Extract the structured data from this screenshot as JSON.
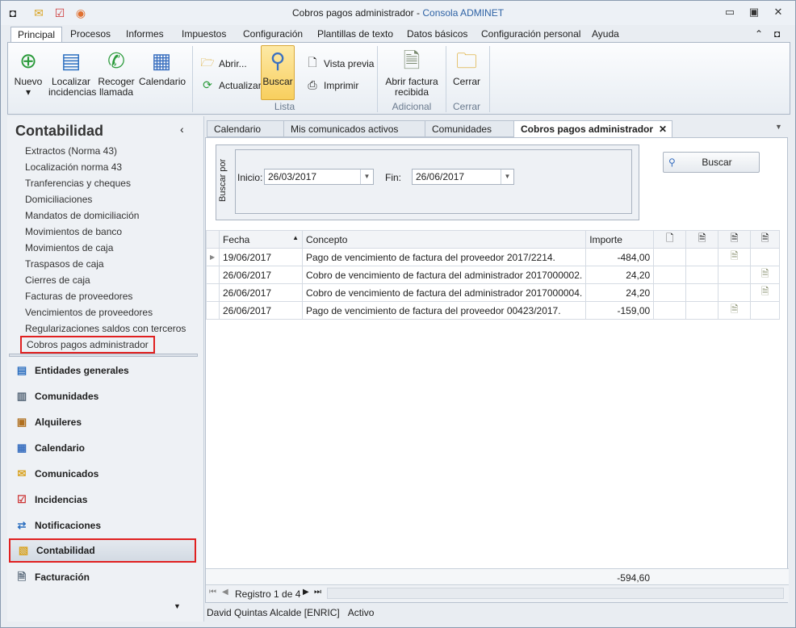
{
  "window": {
    "title": "Cobros pagos administrador",
    "app": "Consola ADMINET",
    "separator": " - "
  },
  "quick_access": [
    "app-icon",
    "mail-icon",
    "tasks-icon",
    "signal-icon"
  ],
  "ribbon_tabs": [
    "Principal",
    "Procesos",
    "Informes",
    "Impuestos",
    "Configuración",
    "Plantillas de texto",
    "Datos básicos",
    "Configuración personal",
    "Ayuda"
  ],
  "ribbon": {
    "nuevo": "Nuevo",
    "localizar": [
      "Localizar",
      "incidencias"
    ],
    "recoger": [
      "Recoger",
      "llamada"
    ],
    "calendario": "Calendario",
    "abrir": "Abrir...",
    "actualizar": "Actualizar",
    "buscar": "Buscar",
    "vista_previa": "Vista previa",
    "imprimir": "Imprimir",
    "abrir_factura": [
      "Abrir factura",
      "recibida"
    ],
    "cerrar": "Cerrar",
    "groups": {
      "lista": "Lista",
      "adicional": "Adicional",
      "cerrar": "Cerrar"
    }
  },
  "sidebar": {
    "title": "Contabilidad",
    "links": [
      "Extractos (Norma 43)",
      "Localización norma 43",
      "Tranferencias y cheques",
      "Domiciliaciones",
      "Mandatos de domiciliación",
      "Movimientos de banco",
      "Movimientos de caja",
      "Traspasos de caja",
      "Cierres de caja",
      "Facturas de proveedores",
      "Vencimientos de proveedores",
      "Regularizaciones saldos con terceros",
      "Cobros pagos administrador"
    ],
    "nav": [
      "Entidades generales",
      "Comunidades",
      "Alquileres",
      "Calendario",
      "Comunicados",
      "Incidencias",
      "Notificaciones",
      "Contabilidad",
      "Facturación"
    ]
  },
  "doc_tabs": [
    "Calendario",
    "Mis comunicados activos",
    "Comunidades",
    "Cobros pagos administrador"
  ],
  "search": {
    "group_label": "Buscar por",
    "inicio_label": "Inicio:",
    "inicio": "26/03/2017",
    "fin_label": "Fin:",
    "fin": "26/06/2017",
    "button": "Buscar"
  },
  "grid": {
    "columns": [
      "Fecha",
      "Concepto",
      "Importe"
    ],
    "rows": [
      {
        "fecha": "19/06/2017",
        "concepto": "Pago de vencimiento de factura del proveedor 2017/2214.",
        "importe": "-484,00",
        "icon_col": 3
      },
      {
        "fecha": "26/06/2017",
        "concepto": "Cobro de vencimiento de factura del administrador  2017000002.",
        "importe": "24,20",
        "icon_col": 4
      },
      {
        "fecha": "26/06/2017",
        "concepto": "Cobro de vencimiento de factura del administrador  2017000004.",
        "importe": "24,20",
        "icon_col": 4
      },
      {
        "fecha": "26/06/2017",
        "concepto": "Pago de vencimiento de factura del proveedor 00423/2017.",
        "importe": "-159,00",
        "icon_col": 3
      }
    ],
    "total": "-594,60",
    "record": "Registro 1 de 4"
  },
  "status": {
    "user": "David Quintas Alcalde [ENRIC]",
    "state": "Activo"
  }
}
